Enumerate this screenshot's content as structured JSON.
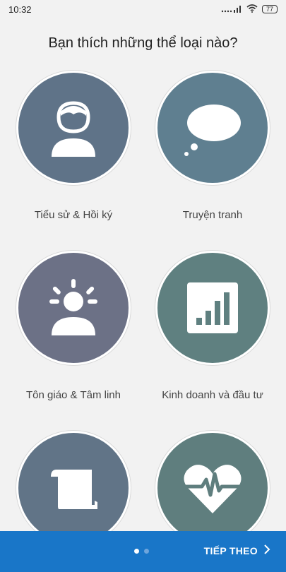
{
  "status_bar": {
    "time": "10:32",
    "signal_text": "....ıl",
    "battery": "77"
  },
  "title": "Bạn thích những thể loại nào?",
  "categories": [
    {
      "label": "Tiểu sử & Hồi ký",
      "icon": "person-icon",
      "color": "#5f7388"
    },
    {
      "label": "Truyện tranh",
      "icon": "speech-bubble-icon",
      "color": "#5f7f90"
    },
    {
      "label": "Tôn giáo & Tâm linh",
      "icon": "sunrise-person-icon",
      "color": "#6c7186"
    },
    {
      "label": "Kinh doanh và đầu tư",
      "icon": "bar-chart-icon",
      "color": "#5f8080"
    },
    {
      "label": "",
      "icon": "scroll-icon",
      "color": "#617487"
    },
    {
      "label": "",
      "icon": "heartbeat-icon",
      "color": "#5f7e7e"
    }
  ],
  "footer": {
    "next_label": "TIẾP THEO",
    "page_indicator": {
      "current": 1,
      "total": 2
    },
    "accent_color": "#1976c8"
  }
}
